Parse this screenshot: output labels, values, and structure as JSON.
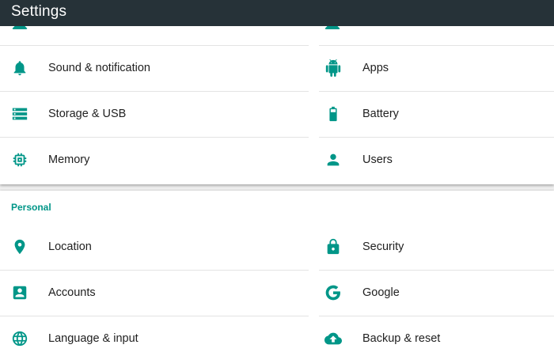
{
  "app": {
    "title": "Settings",
    "accent": "#009688",
    "appbar_color": "#263238",
    "highlight_color": "#e53935"
  },
  "device": {
    "left": [
      {
        "label": "Sound & notification",
        "icon": "bell-icon"
      },
      {
        "label": "Storage & USB",
        "icon": "storage-icon"
      },
      {
        "label": "Memory",
        "icon": "memory-icon"
      }
    ],
    "right": [
      {
        "label": "Apps",
        "icon": "android-icon"
      },
      {
        "label": "Battery",
        "icon": "battery-icon"
      },
      {
        "label": "Users",
        "icon": "person-icon"
      }
    ]
  },
  "personal": {
    "header": "Personal",
    "left": [
      {
        "label": "Location",
        "icon": "location-pin-icon"
      },
      {
        "label": "Accounts",
        "icon": "account-box-icon"
      },
      {
        "label": "Language & input",
        "icon": "globe-icon"
      }
    ],
    "right": [
      {
        "label": "Security",
        "icon": "lock-icon"
      },
      {
        "label": "Google",
        "icon": "google-g-icon"
      },
      {
        "label": "Backup & reset",
        "icon": "cloud-upload-icon",
        "highlighted": true
      }
    ]
  }
}
